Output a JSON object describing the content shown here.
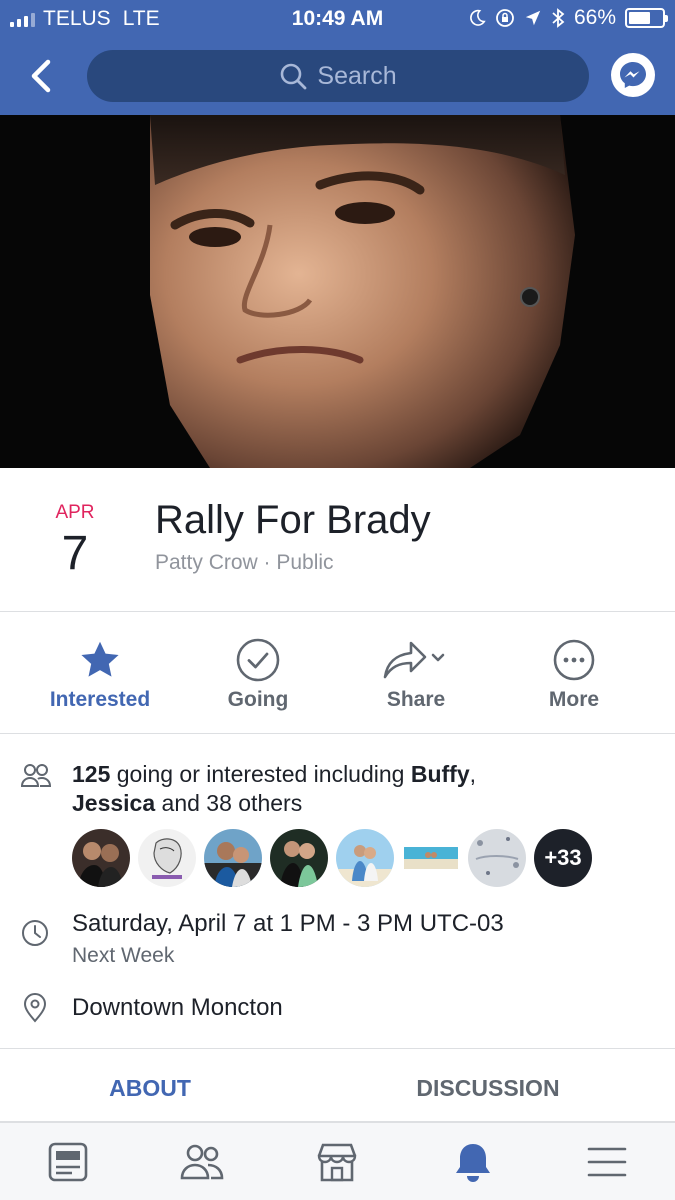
{
  "status_bar": {
    "carrier": "TELUS",
    "network": "LTE",
    "time": "10:49 AM",
    "battery": "66%",
    "battery_level": 0.66
  },
  "nav": {
    "search_placeholder": "Search",
    "back_icon": "chevron-left-icon",
    "messenger_icon": "messenger-icon"
  },
  "event": {
    "month": "APR",
    "day": "7",
    "title": "Rally For Brady",
    "subtitle": "Patty Crow · Public"
  },
  "actions": [
    {
      "label": "Interested",
      "icon": "star-icon",
      "active": true
    },
    {
      "label": "Going",
      "icon": "check-circle-icon",
      "active": false
    },
    {
      "label": "Share",
      "icon": "share-icon",
      "active": false
    },
    {
      "label": "More",
      "icon": "more-icon",
      "active": false
    }
  ],
  "going": {
    "count": "125",
    "text_a": " going or interested including ",
    "name1": "Buffy",
    "comma": ",",
    "name2": "Jessica",
    "text_b": " and 38 others",
    "more_count": "+33"
  },
  "datetime": {
    "main": "Saturday, April 7 at 1 PM - 3 PM UTC-03",
    "sub": "Next Week"
  },
  "location": "Downtown Moncton",
  "tabs": {
    "about": "ABOUT",
    "discussion": "DISCUSSION"
  },
  "bottom_bar": [
    "news-feed-icon",
    "friends-icon",
    "marketplace-icon",
    "notifications-icon",
    "menu-icon"
  ],
  "colors": {
    "brand": "#4267b2",
    "date_month": "#e0245e"
  }
}
